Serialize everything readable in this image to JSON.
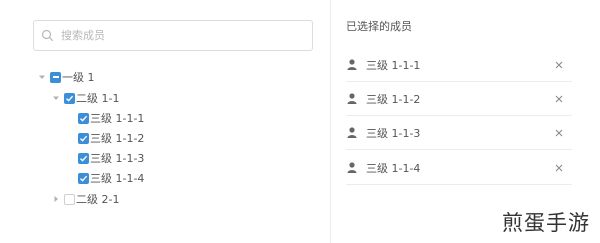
{
  "search": {
    "placeholder": "搜索成员",
    "value": ""
  },
  "tree": {
    "level1": {
      "label": "一级 1",
      "state": "indeterminate",
      "expanded": true
    },
    "level2_a": {
      "label": "二级 1-1",
      "state": "checked",
      "expanded": true
    },
    "level3": [
      {
        "label": "三级 1-1-1",
        "state": "checked"
      },
      {
        "label": "三级 1-1-2",
        "state": "checked"
      },
      {
        "label": "三级 1-1-3",
        "state": "checked"
      },
      {
        "label": "三级 1-1-4",
        "state": "checked"
      }
    ],
    "level2_b": {
      "label": "二级 2-1",
      "state": "unchecked",
      "expanded": false
    }
  },
  "selected": {
    "title": "已选择的成员",
    "items": [
      {
        "name": "三级 1-1-1"
      },
      {
        "name": "三级 1-1-2"
      },
      {
        "name": "三级 1-1-3"
      },
      {
        "name": "三级 1-1-4"
      }
    ]
  },
  "colors": {
    "accent": "#3b8fd8",
    "border": "#dcdcdc",
    "divider": "#ececec"
  },
  "watermark": "煎蛋手游"
}
